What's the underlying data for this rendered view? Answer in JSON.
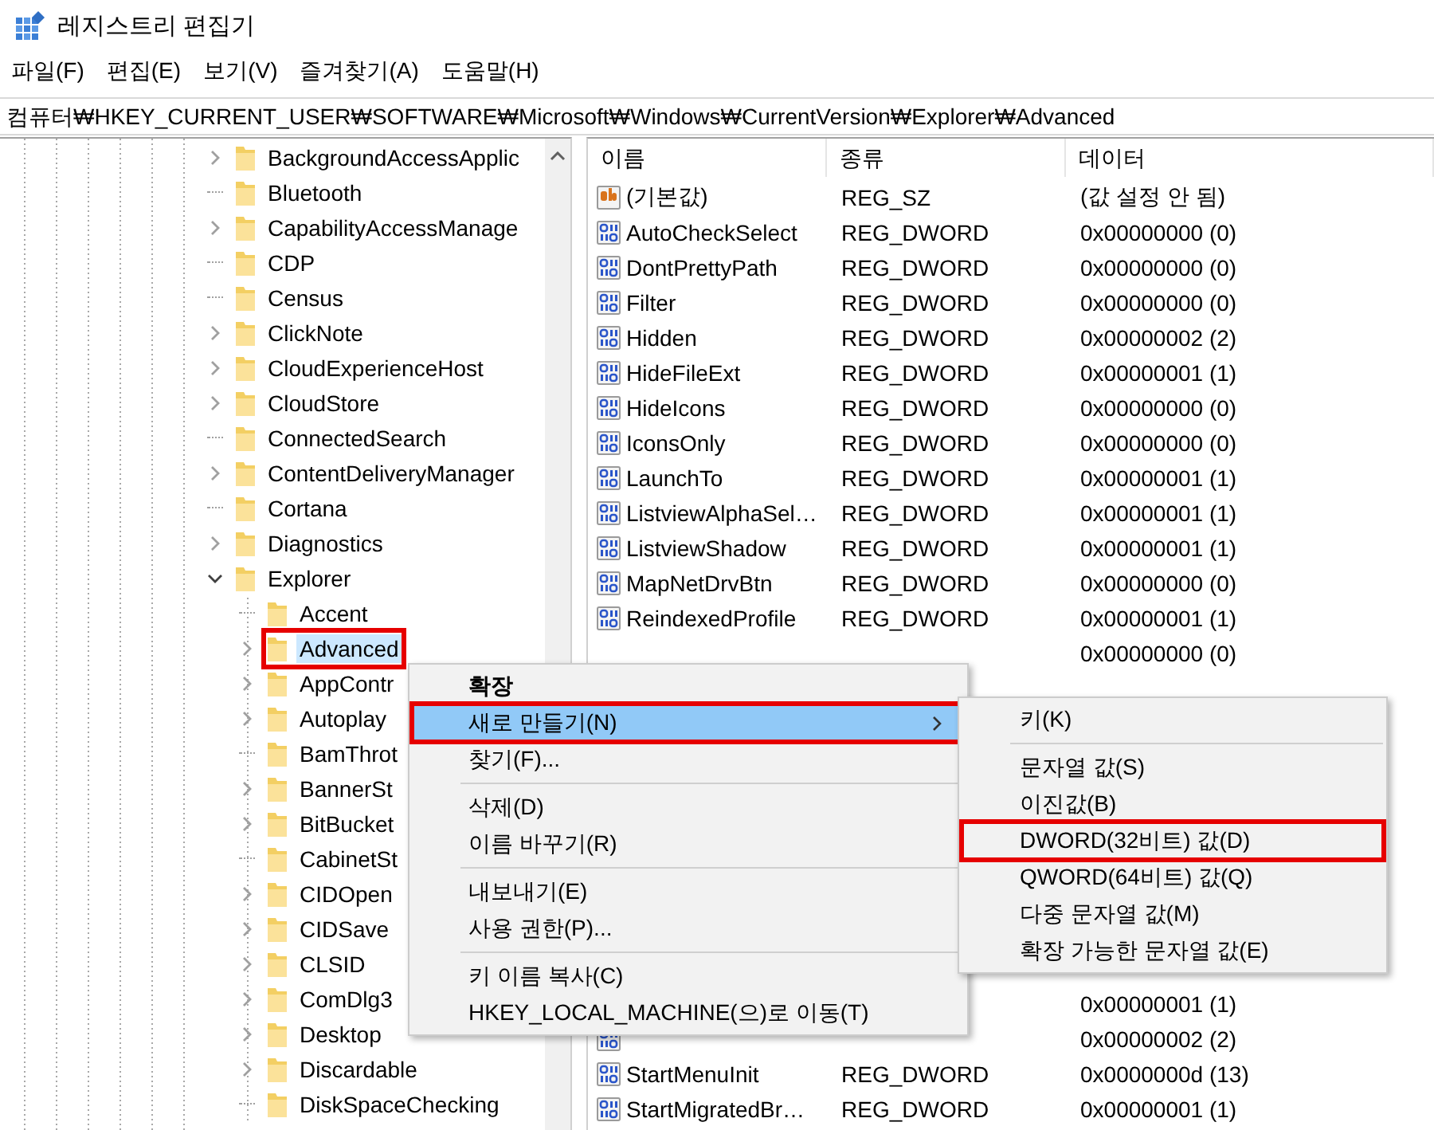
{
  "window": {
    "title": "레지스트리 편집기"
  },
  "menu_bar": [
    "파일(F)",
    "편집(E)",
    "보기(V)",
    "즐겨찾기(A)",
    "도움말(H)"
  ],
  "address": "컴퓨터₩HKEY_CURRENT_USER₩SOFTWARE₩Microsoft₩Windows₩CurrentVersion₩Explorer₩Advanced",
  "tree": {
    "items": [
      {
        "label": "BackgroundAccessApplic",
        "expandable": true,
        "selected": false
      },
      {
        "label": "Bluetooth",
        "expandable": false,
        "selected": false
      },
      {
        "label": "CapabilityAccessManage",
        "expandable": true,
        "selected": false
      },
      {
        "label": "CDP",
        "expandable": false,
        "selected": false
      },
      {
        "label": "Census",
        "expandable": false,
        "selected": false
      },
      {
        "label": "ClickNote",
        "expandable": true,
        "selected": false
      },
      {
        "label": "CloudExperienceHost",
        "expandable": true,
        "selected": false
      },
      {
        "label": "CloudStore",
        "expandable": true,
        "selected": false
      },
      {
        "label": "ConnectedSearch",
        "expandable": false,
        "selected": false
      },
      {
        "label": "ContentDeliveryManager",
        "expandable": true,
        "selected": false
      },
      {
        "label": "Cortana",
        "expandable": false,
        "selected": false
      },
      {
        "label": "Diagnostics",
        "expandable": true,
        "selected": false
      },
      {
        "label": "Explorer",
        "expandable": true,
        "expanded": true,
        "selected": false,
        "children": [
          {
            "label": "Accent",
            "expandable": false,
            "selected": false
          },
          {
            "label": "Advanced",
            "expandable": true,
            "selected": true,
            "annotated": true
          },
          {
            "label": "AppContr",
            "expandable": true,
            "selected": false
          },
          {
            "label": "Autoplay",
            "expandable": true,
            "selected": false
          },
          {
            "label": "BamThrot",
            "expandable": false,
            "selected": false
          },
          {
            "label": "BannerSt",
            "expandable": true,
            "selected": false
          },
          {
            "label": "BitBucket",
            "expandable": true,
            "selected": false
          },
          {
            "label": "CabinetSt",
            "expandable": false,
            "selected": false
          },
          {
            "label": "CIDOpen",
            "expandable": true,
            "selected": false
          },
          {
            "label": "CIDSave",
            "expandable": true,
            "selected": false
          },
          {
            "label": "CLSID",
            "expandable": true,
            "selected": false
          },
          {
            "label": "ComDlg3",
            "expandable": true,
            "selected": false
          },
          {
            "label": "Desktop",
            "expandable": true,
            "selected": false
          },
          {
            "label": "Discardable",
            "expandable": true,
            "selected": false
          },
          {
            "label": "DiskSpaceChecking",
            "expandable": false,
            "selected": false
          }
        ]
      }
    ]
  },
  "list": {
    "columns": [
      "이름",
      "종류",
      "데이터"
    ],
    "rows_top": [
      {
        "kind": "string",
        "name": "(기본값)",
        "type": "REG_SZ",
        "data": "(값 설정 안 됨)"
      },
      {
        "kind": "dword",
        "name": "AutoCheckSelect",
        "type": "REG_DWORD",
        "data": "0x00000000 (0)"
      },
      {
        "kind": "dword",
        "name": "DontPrettyPath",
        "type": "REG_DWORD",
        "data": "0x00000000 (0)"
      },
      {
        "kind": "dword",
        "name": "Filter",
        "type": "REG_DWORD",
        "data": "0x00000000 (0)"
      },
      {
        "kind": "dword",
        "name": "Hidden",
        "type": "REG_DWORD",
        "data": "0x00000002 (2)"
      },
      {
        "kind": "dword",
        "name": "HideFileExt",
        "type": "REG_DWORD",
        "data": "0x00000001 (1)"
      },
      {
        "kind": "dword",
        "name": "HideIcons",
        "type": "REG_DWORD",
        "data": "0x00000000 (0)"
      },
      {
        "kind": "dword",
        "name": "IconsOnly",
        "type": "REG_DWORD",
        "data": "0x00000000 (0)"
      },
      {
        "kind": "dword",
        "name": "LaunchTo",
        "type": "REG_DWORD",
        "data": "0x00000001 (1)"
      },
      {
        "kind": "dword",
        "name": "ListviewAlphaSel…",
        "type": "REG_DWORD",
        "data": "0x00000001 (1)"
      },
      {
        "kind": "dword",
        "name": "ListviewShadow",
        "type": "REG_DWORD",
        "data": "0x00000001 (1)"
      },
      {
        "kind": "dword",
        "name": "MapNetDrvBtn",
        "type": "REG_DWORD",
        "data": "0x00000000 (0)"
      },
      {
        "kind": "dword",
        "name": "ReindexedProfile",
        "type": "REG_DWORD",
        "data": "0x00000001 (1)"
      },
      {
        "data": "0x00000000 (0)"
      }
    ],
    "rows_bottom": [
      {
        "data": "0x00000001 (1)"
      },
      {
        "kind": "dword",
        "data": "0x00000002 (2)"
      },
      {
        "kind": "dword",
        "name": "StartMenuInit",
        "type": "REG_DWORD",
        "data": "0x0000000d (13)"
      },
      {
        "kind": "dword",
        "name": "StartMigratedBr…",
        "type": "REG_DWORD",
        "data": "0x00000001 (1)"
      }
    ]
  },
  "context_menu": {
    "items": [
      {
        "kind": "item",
        "label": "확장",
        "bold": true,
        "selected": false
      },
      {
        "kind": "item",
        "label": "새로 만들기(N)",
        "selected": true,
        "submenu": true,
        "annotated": true
      },
      {
        "kind": "item",
        "label": "찾기(F)...",
        "selected": false
      },
      {
        "kind": "separator"
      },
      {
        "kind": "item",
        "label": "삭제(D)",
        "selected": false
      },
      {
        "kind": "item",
        "label": "이름 바꾸기(R)",
        "selected": false
      },
      {
        "kind": "separator"
      },
      {
        "kind": "item",
        "label": "내보내기(E)",
        "selected": false
      },
      {
        "kind": "item",
        "label": "사용 권한(P)...",
        "selected": false
      },
      {
        "kind": "separator"
      },
      {
        "kind": "item",
        "label": "키 이름 복사(C)",
        "selected": false
      },
      {
        "kind": "item",
        "label": "HKEY_LOCAL_MACHINE(으)로 이동(T)",
        "selected": false
      }
    ]
  },
  "submenu": {
    "items": [
      {
        "kind": "item",
        "label": "키(K)",
        "selected": false
      },
      {
        "kind": "separator"
      },
      {
        "kind": "item",
        "label": "문자열 값(S)",
        "selected": false
      },
      {
        "kind": "item",
        "label": "이진값(B)",
        "selected": false
      },
      {
        "kind": "item",
        "label": "DWORD(32비트) 값(D)",
        "selected": false,
        "annotated": true
      },
      {
        "kind": "item",
        "label": "QWORD(64비트) 값(Q)",
        "selected": false
      },
      {
        "kind": "item",
        "label": "다중 문자열 값(M)",
        "selected": false
      },
      {
        "kind": "item",
        "label": "확장 가능한 문자열 값(E)",
        "selected": false
      }
    ]
  }
}
